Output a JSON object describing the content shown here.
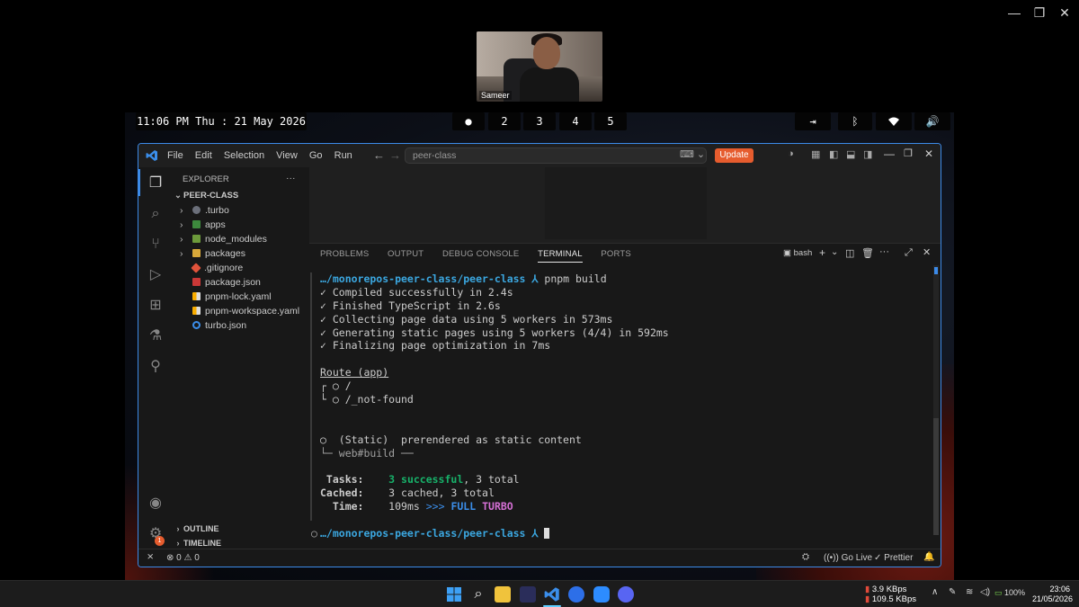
{
  "webcam": {
    "name": "Sameer"
  },
  "topbar": {
    "clock": "11:06 PM Thu : 21 May 2026",
    "workspaces": [
      "●",
      "2",
      "3",
      "4",
      "5"
    ]
  },
  "titlebar": {
    "menu": [
      "File",
      "Edit",
      "Selection",
      "View",
      "Go",
      "Run"
    ],
    "search": "peer-class",
    "update_label": "Update"
  },
  "explorer": {
    "header": "EXPLORER",
    "root": "PEER-CLASS",
    "folders": [
      ".turbo",
      "apps",
      "node_modules",
      "packages"
    ],
    "files": [
      ".gitignore",
      "package.json",
      "pnpm-lock.yaml",
      "pnpm-workspace.yaml",
      "turbo.json"
    ],
    "outline": "OUTLINE",
    "timeline": "TIMELINE"
  },
  "panel": {
    "tabs": [
      "PROBLEMS",
      "OUTPUT",
      "DEBUG CONSOLE",
      "TERMINAL",
      "PORTS"
    ],
    "shell": "bash"
  },
  "terminal": {
    "prompt_path": "…/monorepos-peer-class/peer-class",
    "prompt_arrow": "⅄",
    "command": "pnpm build",
    "lines": [
      "✓ Compiled successfully in 2.4s",
      "✓ Finished TypeScript in 2.6s",
      "✓ Collecting page data using 5 workers in 573ms",
      "✓ Generating static pages using 5 workers (4/4) in 592ms",
      "✓ Finalizing page optimization in 7ms"
    ],
    "route_header": "Route (app)",
    "routes": [
      "┌ ○ /",
      "└ ○ /_not-found"
    ],
    "static_note": "○  (Static)  prerendered as static content",
    "build_line": "└─ web#build ──",
    "tasks_label": " Tasks:",
    "tasks_success": "3 successful",
    "tasks_total": ", 3 total",
    "cached_label": "Cached:",
    "cached_value": "3 cached, 3 total",
    "time_label": "  Time:",
    "time_value": "109ms",
    "time_arrows": ">>>",
    "full": "FULL",
    "turbo": "TURBO",
    "final_prompt_dot": "○"
  },
  "statusbar": {
    "errors": "0",
    "warnings": "0",
    "go_live": "Go Live",
    "prettier": "Prettier"
  },
  "taskbar": {
    "net_up": "3.9 KBps",
    "net_down": "109.5 KBps",
    "battery": "100%",
    "time": "23:06",
    "date": "21/05/2026"
  },
  "colors": {
    "accent": "#3c8ae8",
    "update": "#e65c2e",
    "success": "#17b26a",
    "path": "#3ba7e0",
    "turbo": "#d670d6"
  }
}
